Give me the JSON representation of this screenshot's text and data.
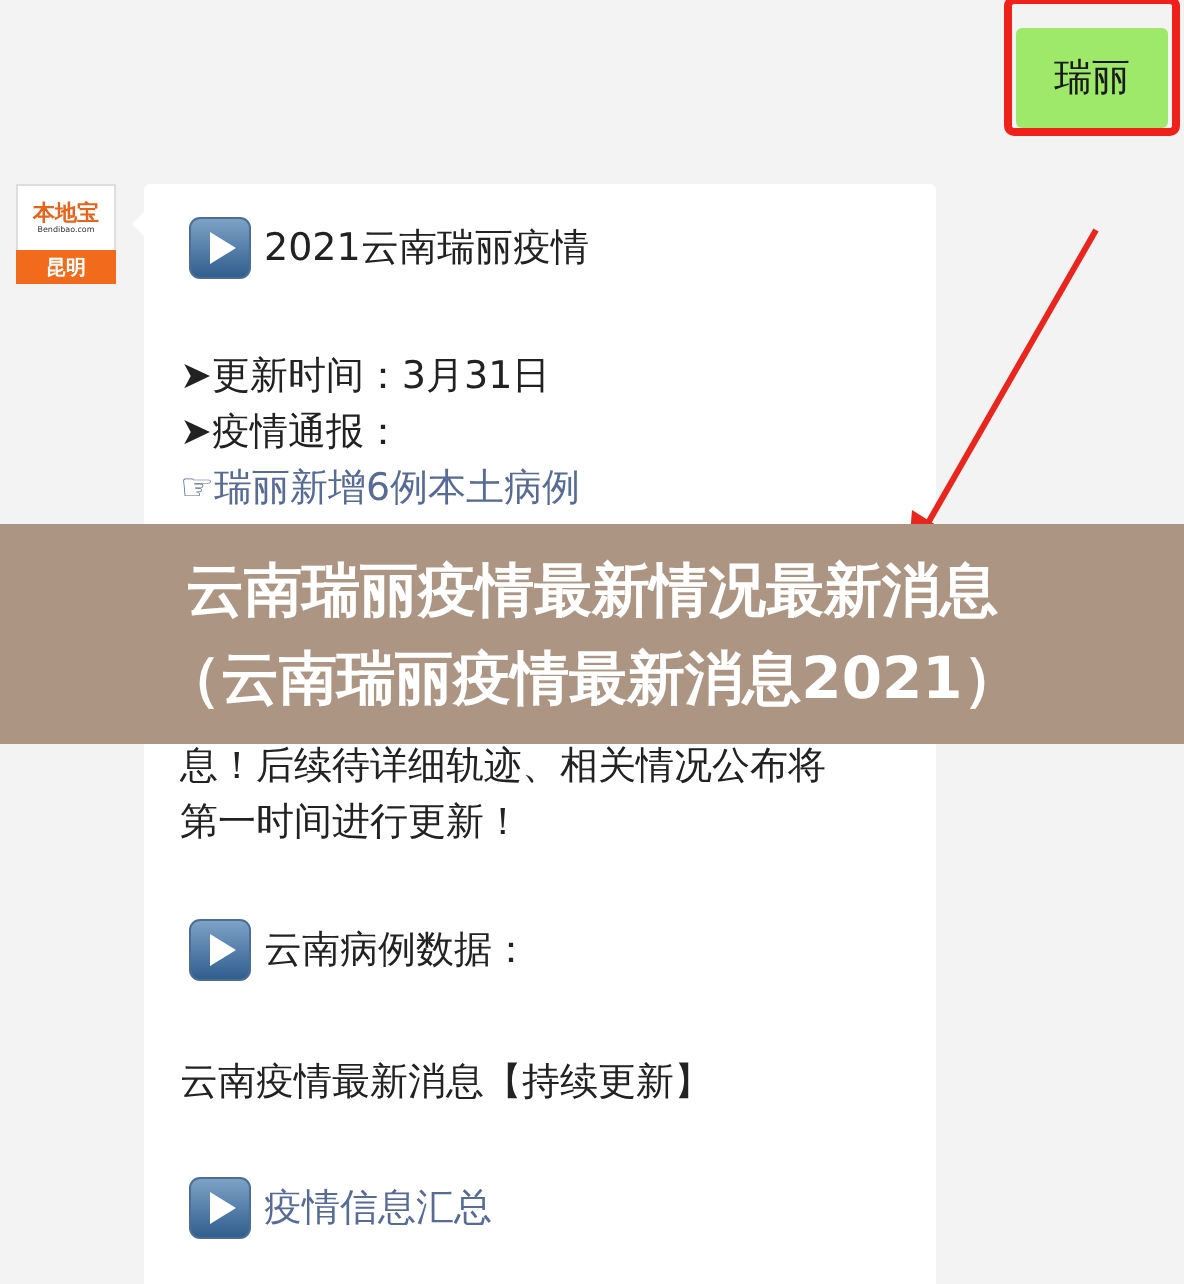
{
  "sent_message": {
    "text": "瑞丽"
  },
  "avatar": {
    "brand": "本地宝",
    "domain": "Bendibao.com",
    "city": "昆明"
  },
  "received_message": {
    "blocks": [
      {
        "kind": "heading",
        "text": "2021云南瑞丽疫情",
        "link": false
      },
      {
        "kind": "line",
        "text": "➤更新时间：3月31日",
        "link": false
      },
      {
        "kind": "line",
        "text": "➤疫情通报：",
        "link": false
      },
      {
        "kind": "line",
        "text": "☞瑞丽新增6例本土病例",
        "link": true
      },
      {
        "kind": "gap"
      },
      {
        "kind": "line",
        "text": "息！后续待详细轨迹、相关情况公布将",
        "link": false
      },
      {
        "kind": "line",
        "text": "第一时间进行更新！",
        "link": false
      },
      {
        "kind": "heading",
        "text": "云南病例数据：",
        "link": false
      },
      {
        "kind": "paragraph",
        "text": "云南疫情最新消息【持续更新】",
        "link": false
      },
      {
        "kind": "heading",
        "text": "疫情信息汇总",
        "link": true
      }
    ]
  },
  "banner": {
    "lines": [
      "云南瑞丽疫情最新情况最新消息",
      "（云南瑞丽疫情最新消息2021）"
    ]
  }
}
